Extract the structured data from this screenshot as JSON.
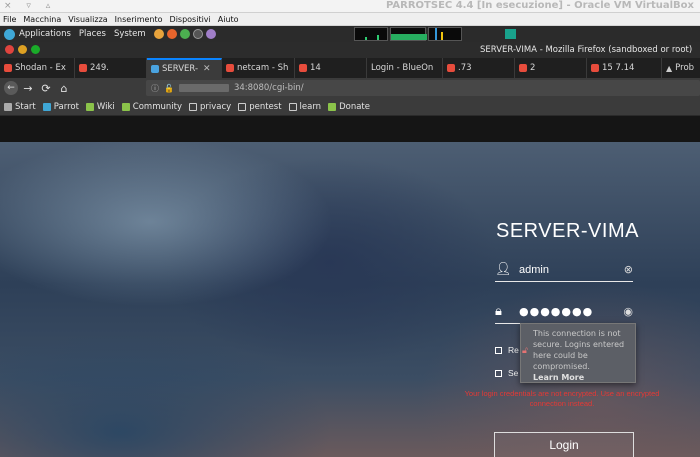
{
  "vbox": {
    "title": "PARROTSEC 4.4 [In esecuzione] - Oracle VM VirtualBox",
    "window_controls": "× ▿ ▵",
    "menu": [
      "File",
      "Macchina",
      "Visualizza",
      "Inserimento",
      "Dispositivi",
      "Aiuto"
    ]
  },
  "panel": {
    "items": [
      "Applications",
      "Places",
      "System"
    ]
  },
  "firefox": {
    "window_title": "SERVER-VIMA - Mozilla Firefox (sandboxed or root)",
    "tabs": [
      {
        "label": "Shodan - Ex"
      },
      {
        "label": "249."
      },
      {
        "label": "SERVER-",
        "active": true
      },
      {
        "label": "netcam - Sh"
      },
      {
        "label": "14"
      },
      {
        "label": "Login - BlueOn"
      },
      {
        "label": ".73"
      },
      {
        "label": "2"
      },
      {
        "label": "15 7.14"
      },
      {
        "label": "Prob"
      }
    ],
    "url": "34:8080/cgi-bin/",
    "bookmarks": [
      "Start",
      "Parrot",
      "Wiki",
      "Community",
      "privacy",
      "pentest",
      "learn",
      "Donate"
    ]
  },
  "login": {
    "title": "SERVER-VIMA",
    "username": "admin",
    "password_dots": "●●●●●●●",
    "tooltip": {
      "text": "This connection is not secure. Logins entered here could be compromised.",
      "learn_more": "Learn More"
    },
    "checkbox1_label": "Re",
    "checkbox2_label": "Se",
    "warning": "Your login credentials are not encrypted. Use an encrypted connection instead.",
    "login_button": "Login"
  }
}
